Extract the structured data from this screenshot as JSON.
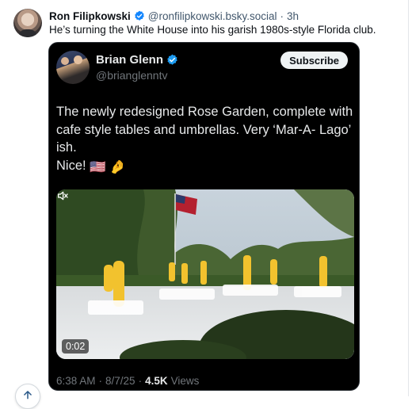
{
  "post": {
    "author_name": "Ron Filipkowski",
    "handle": "@ronfilipkowski.bsky.social",
    "separator": "·",
    "time": "3h",
    "text": "He’s turning the White House into his garish 1980s-style Florida club."
  },
  "embed": {
    "author_name": "Brian Glenn",
    "handle": "@brianglenntv",
    "subscribe_label": "Subscribe",
    "text_lines": [
      "The newly redesigned Rose Garden, complete with",
      "cafe style tables and umbrellas. Very ‘Mar-A- Lago’",
      "ish.",
      "Nice!"
    ],
    "emojis": [
      "🇺🇸",
      "🤌"
    ],
    "video_time": "0:02",
    "footer": {
      "time": "6:38 AM",
      "separator": "·",
      "date": "8/7/25",
      "separator2": "·",
      "views_count": "4.5K",
      "views_label": "Views"
    }
  },
  "icons": {
    "verified": "verified-check-icon",
    "mute": "speaker-muted-icon",
    "scroll": "arrow-up-icon"
  },
  "colors": {
    "bsky_verified": "#1185fe",
    "x_verified": "#1d9bf0",
    "umbrella": "#f2c22e"
  }
}
